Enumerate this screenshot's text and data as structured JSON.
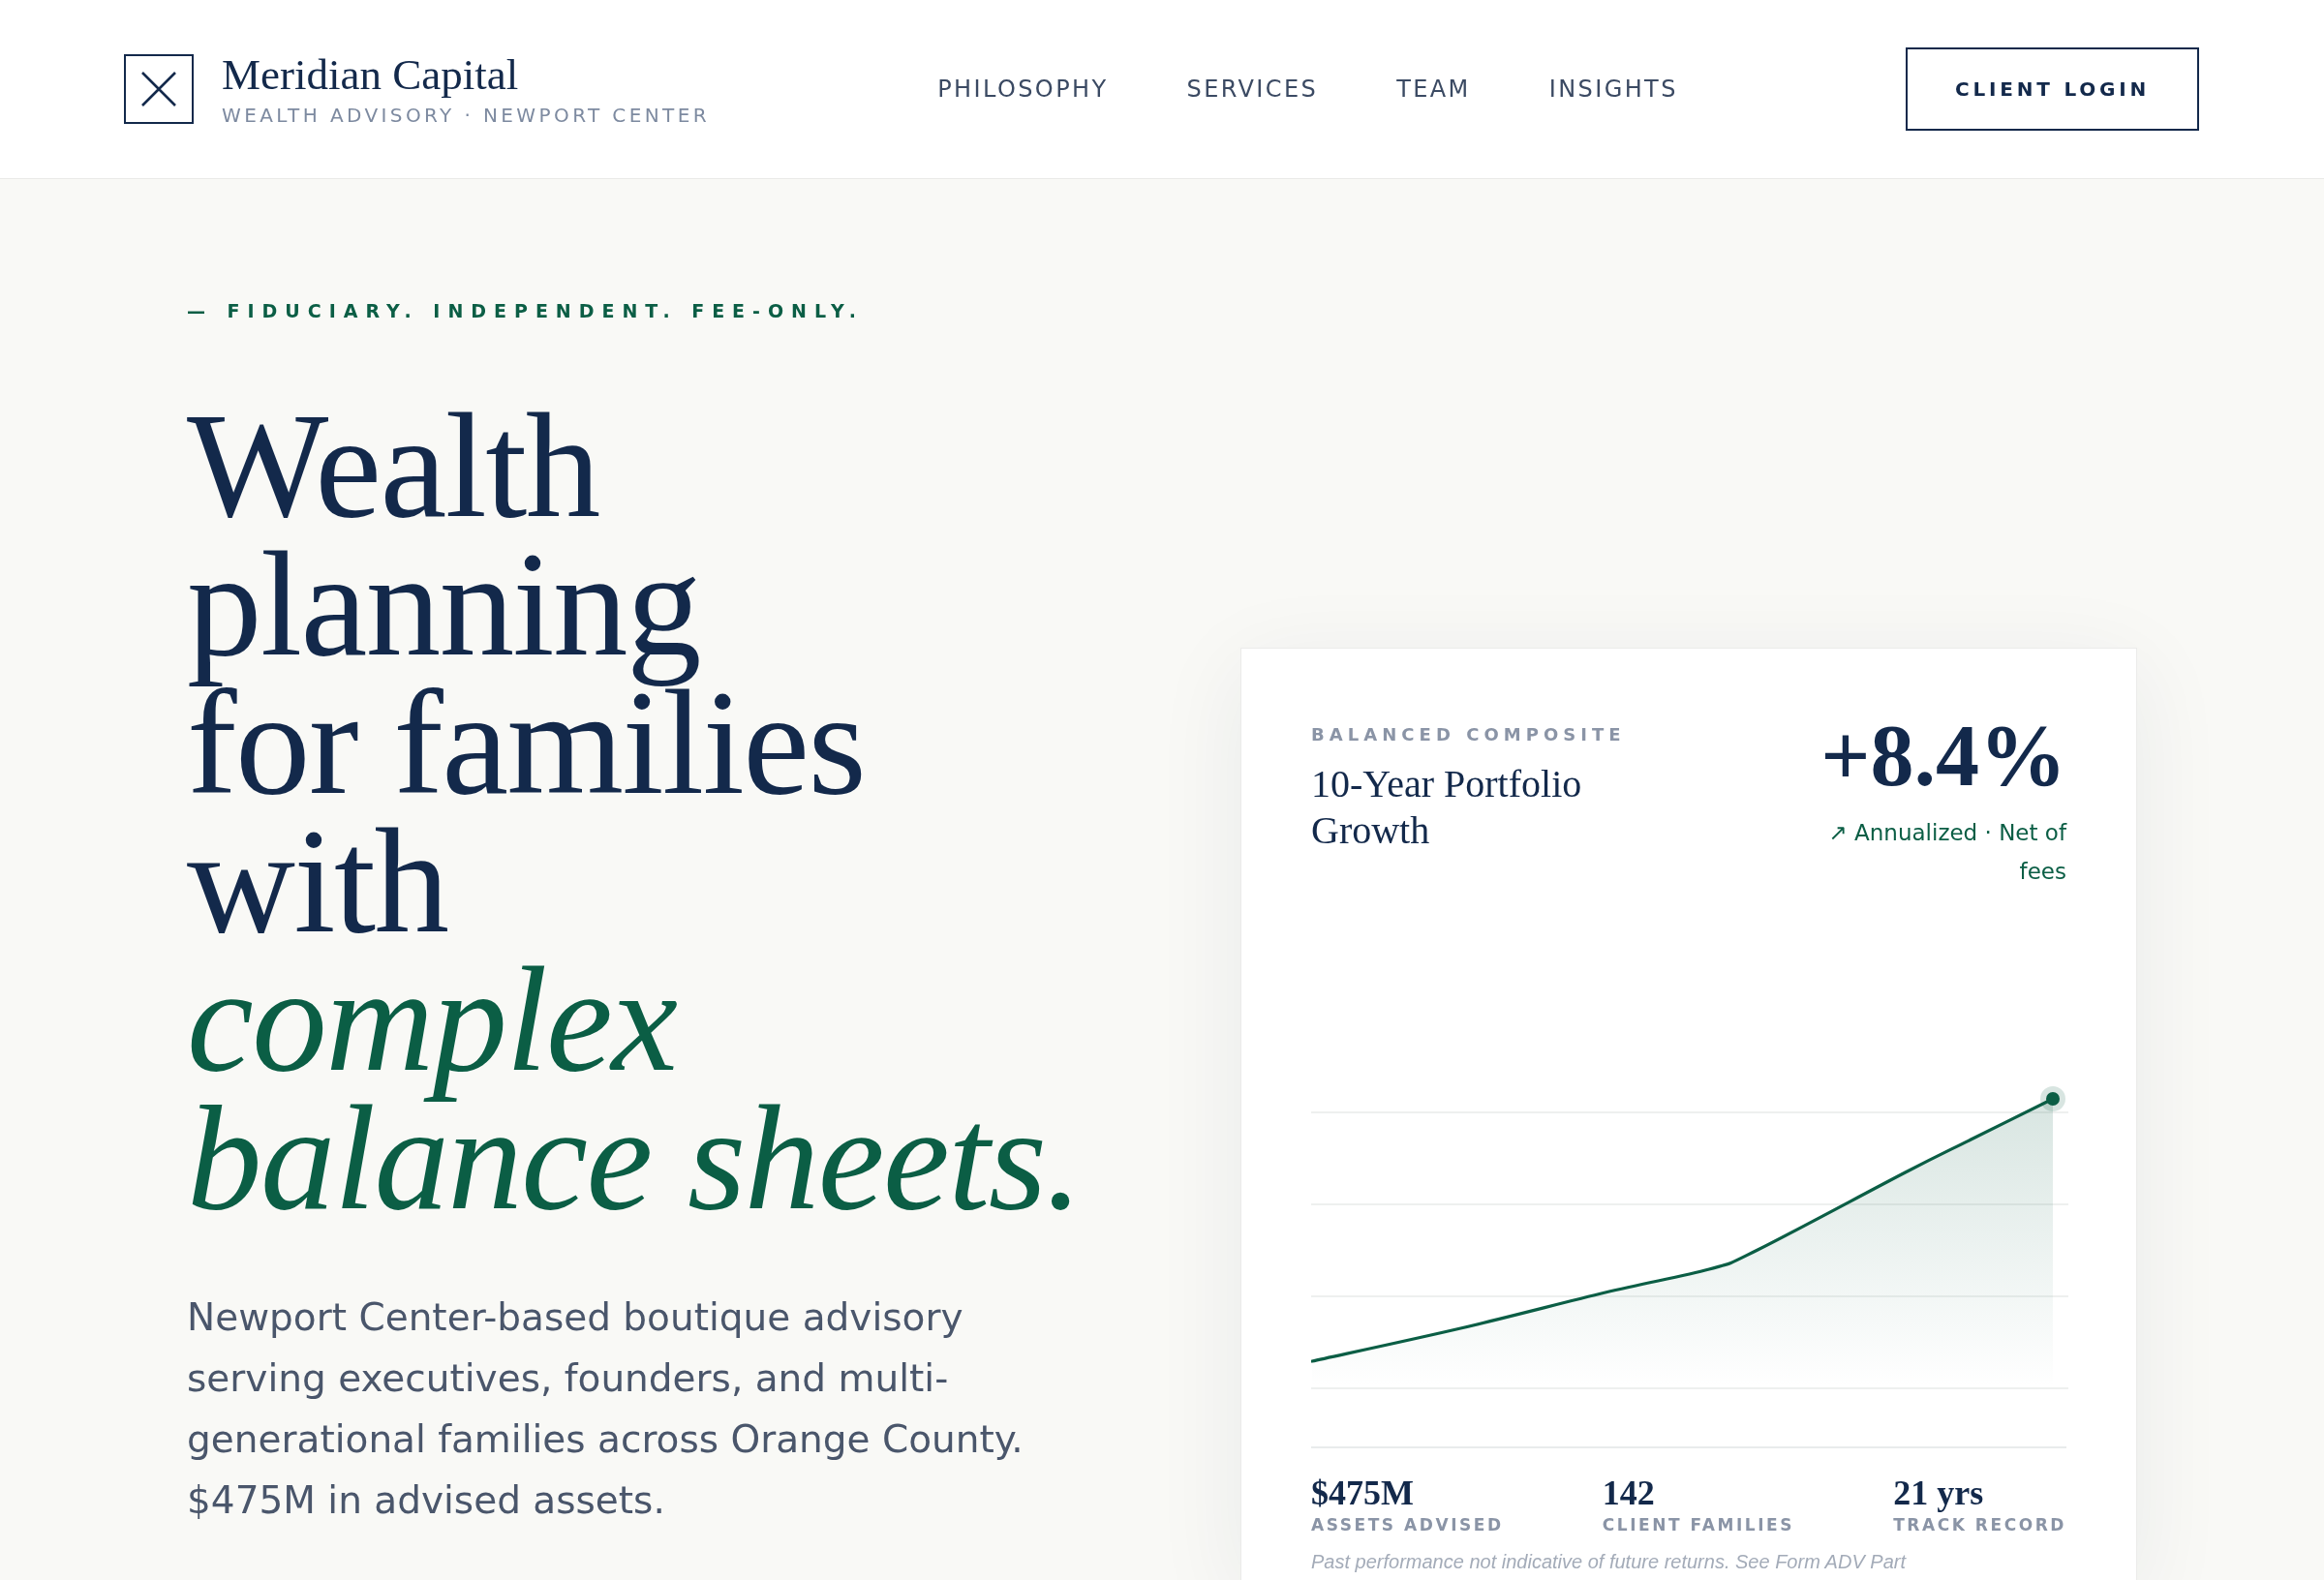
{
  "header": {
    "brand": {
      "name": "Meridian Capital",
      "tagline": "WEALTH ADVISORY · NEWPORT CENTER"
    },
    "nav": [
      "PHILOSOPHY",
      "SERVICES",
      "TEAM",
      "INSIGHTS"
    ],
    "login_button": "CLIENT LOGIN"
  },
  "hero": {
    "eyebrow": "— FIDUCIARY. INDEPENDENT. FEE-ONLY.",
    "headline": "Wealth\nplanning\nfor families\nwith\n*complex*\n*balance sheets.*",
    "intro": "Newport Center-based boutique advisory serving executives, founders, and multi-generational families across Orange County. $475M in advised assets."
  },
  "performance_card": {
    "eyebrow": "BALANCED COMPOSITE",
    "title": "10-Year Portfolio Growth",
    "return": "+8.4%",
    "return_note": "↗ Annualized · Net of fees",
    "stats": [
      {
        "value": "$475M",
        "label": "ASSETS ADVISED"
      },
      {
        "value": "142",
        "label": "CLIENT FAMILIES"
      },
      {
        "value": "21 yrs",
        "label": "TRACK RECORD"
      }
    ],
    "disclaimer": "Past performance not indicative of future returns. See Form ADV Part"
  }
}
